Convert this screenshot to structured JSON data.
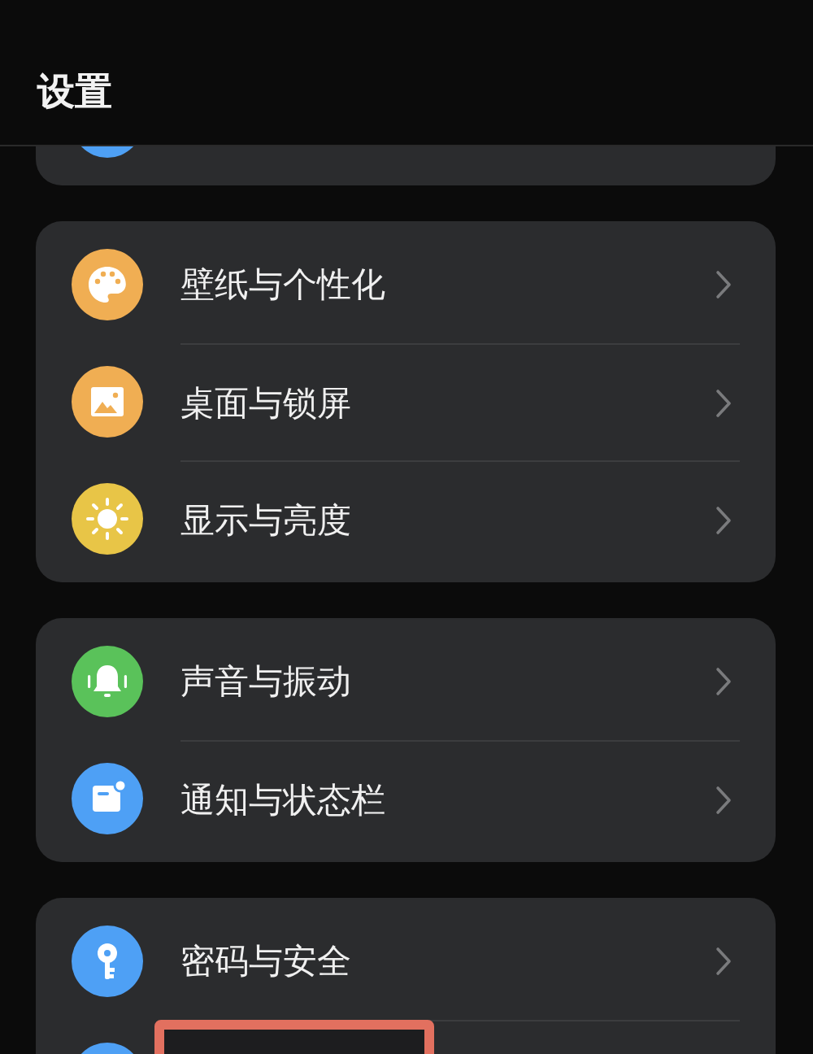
{
  "title": "设置",
  "groups": [
    {
      "items": [
        {
          "kind": "blank",
          "highlighted": false
        }
      ]
    },
    {
      "items": [
        {
          "kind": "palette",
          "label": "壁纸与个性化",
          "highlighted": false
        },
        {
          "kind": "picture",
          "label": "桌面与锁屏",
          "highlighted": false
        },
        {
          "kind": "sun",
          "label": "显示与亮度",
          "highlighted": false
        }
      ]
    },
    {
      "items": [
        {
          "kind": "bell",
          "label": "声音与振动",
          "highlighted": false
        },
        {
          "kind": "notice",
          "label": "通知与状态栏",
          "highlighted": false
        }
      ]
    },
    {
      "items": [
        {
          "kind": "key",
          "label": "密码与安全",
          "highlighted": false
        },
        {
          "kind": "blank",
          "highlighted": true
        }
      ]
    }
  ]
}
